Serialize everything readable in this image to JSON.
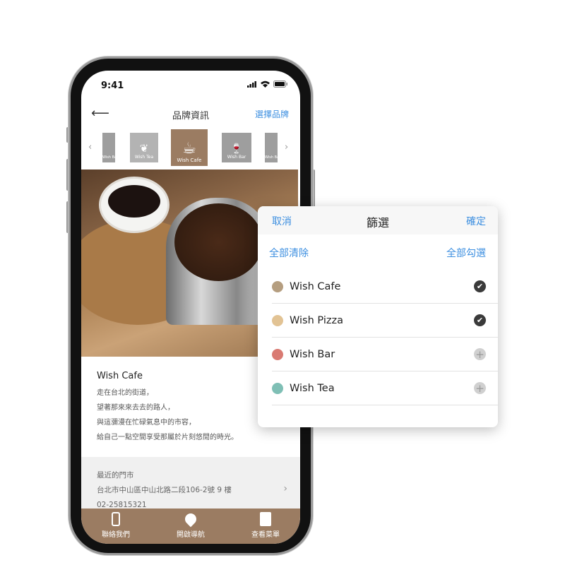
{
  "status": {
    "time": "9:41"
  },
  "header": {
    "title": "品牌資訊",
    "select_brand": "選擇品牌"
  },
  "carousel": {
    "items": [
      {
        "label": "Wish Bar"
      },
      {
        "label": "Wish Tea"
      },
      {
        "label": "Wish Cafe",
        "active": true
      },
      {
        "label": "Wish Bar"
      },
      {
        "label": "Wish Bar"
      }
    ],
    "active_color": "#9b7c62"
  },
  "brand": {
    "name": "Wish Cafe",
    "lines": [
      "走在台北的街道，",
      "望著那來來去去的路人，",
      "與這瀰漫在忙碌氣息中的市容，",
      "給自己一點空間享受那屬於片刻悠閒的時光。"
    ]
  },
  "store": {
    "label": "最近的門市",
    "address": "台北市中山區中山北路二段106-2號 9 樓",
    "phone": "02-25815321"
  },
  "tabbar": {
    "items": [
      {
        "label": "聯絡我們",
        "icon": "phone-icon"
      },
      {
        "label": "開啟導航",
        "icon": "map-pin-icon"
      },
      {
        "label": "查看菜單",
        "icon": "menu-book-icon"
      }
    ]
  },
  "filter": {
    "cancel": "取消",
    "title": "篩選",
    "confirm": "確定",
    "clear_all": "全部清除",
    "select_all": "全部勾選",
    "items": [
      {
        "label": "Wish Cafe",
        "checked": true,
        "color": "#b59e80"
      },
      {
        "label": "Wish Pizza",
        "checked": true,
        "color": "#e2c394"
      },
      {
        "label": "Wish Bar",
        "checked": false,
        "color": "#d97a72"
      },
      {
        "label": "Wish Tea",
        "checked": false,
        "color": "#7fbfb5"
      }
    ]
  }
}
